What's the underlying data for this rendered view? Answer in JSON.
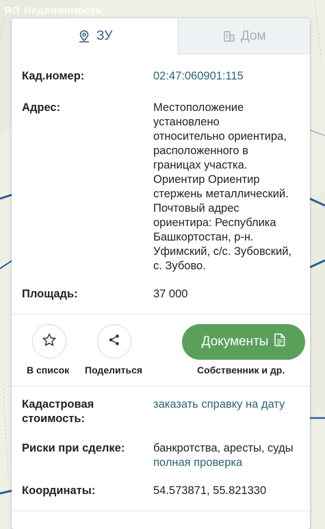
{
  "watermark": {
    "logo": "ЯО",
    "text": "Недвижимость"
  },
  "tabs": [
    {
      "label": "ЗУ",
      "icon": "map-pin-icon",
      "active": true
    },
    {
      "label": "Дом",
      "icon": "building-icon",
      "active": false
    }
  ],
  "info": {
    "kad_label": "Кад.номер:",
    "kad_value": "02:47:060901:115",
    "addr_label": "Адрес:",
    "addr_lines": [
      "Местоположение",
      "установлено",
      "относительно ориентира,",
      "расположенного в",
      "границах участка.",
      "Ориентир Ориентир",
      "стержень металлический.",
      "Почтовый адрес",
      "ориентира: Республика",
      "Башкортостан, р-н.",
      "Уфимский, с/с. Зубовский,",
      "с. Зубово."
    ],
    "area_label": "Площадь:",
    "area_value": "37 000"
  },
  "actions": {
    "add_list_label": "В список",
    "share_label": "Поделиться",
    "docs_button": "Документы",
    "docs_sub_label": "Собственник и др."
  },
  "details": {
    "cad_cost_label_1": "Кадастровая",
    "cad_cost_label_2": "стоимость:",
    "cad_cost_link": "заказать справку на дату",
    "risks_label": "Риски при сделке:",
    "risks_value": "банкротства, аресты, суды",
    "risks_link": "полная проверка",
    "coords_label": "Координаты:",
    "coords_value": "54.573871, 55.821330"
  },
  "colors": {
    "accent_green": "#5aa05b",
    "link": "#2c6472",
    "map_line": "#2a5aa0"
  }
}
